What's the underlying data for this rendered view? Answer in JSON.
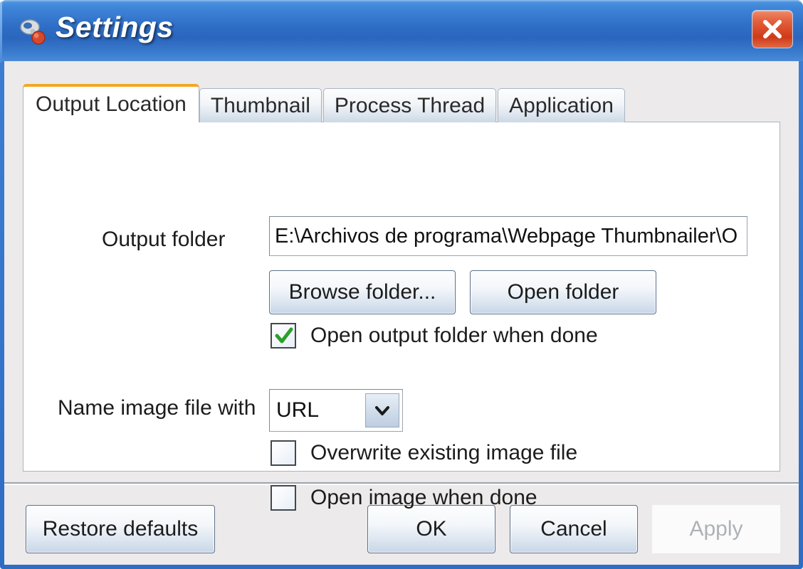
{
  "window": {
    "title": "Settings",
    "icon": "wrench-icon",
    "close_icon": "close-icon",
    "accent_titlebar": "#2f6ec6",
    "accent_close": "#cf3a18",
    "accent_active_tab": "#f5a623"
  },
  "tabs": [
    {
      "label": "Output Location",
      "active": true,
      "name": "tab-output-location"
    },
    {
      "label": "Thumbnail",
      "active": false,
      "name": "tab-thumbnail"
    },
    {
      "label": "Process Thread",
      "active": false,
      "name": "tab-process-thread"
    },
    {
      "label": "Application",
      "active": false,
      "name": "tab-application"
    }
  ],
  "output_location": {
    "output_folder_label": "Output folder",
    "output_folder_value": "E:\\Archivos de programa\\Webpage Thumbnailer\\O",
    "output_folder_placeholder": "",
    "browse_folder_label": "Browse folder...",
    "open_folder_label": "Open folder",
    "open_output_folder_when_done": {
      "label": "Open output folder when done",
      "checked": true,
      "check_color": "#2aa02a"
    },
    "name_image_file_with_label": "Name image file with",
    "name_image_file_with_value": "URL",
    "name_image_file_options": [
      "URL"
    ],
    "dropdown_icon": "chevron-down-icon",
    "overwrite_existing_image_file": {
      "label": "Overwrite existing image file",
      "checked": false
    },
    "open_image_when_done": {
      "label": "Open image when done",
      "checked": false
    }
  },
  "footer": {
    "restore_defaults_label": "Restore defaults",
    "ok_label": "OK",
    "cancel_label": "Cancel",
    "apply_label": "Apply",
    "apply_enabled": false
  }
}
